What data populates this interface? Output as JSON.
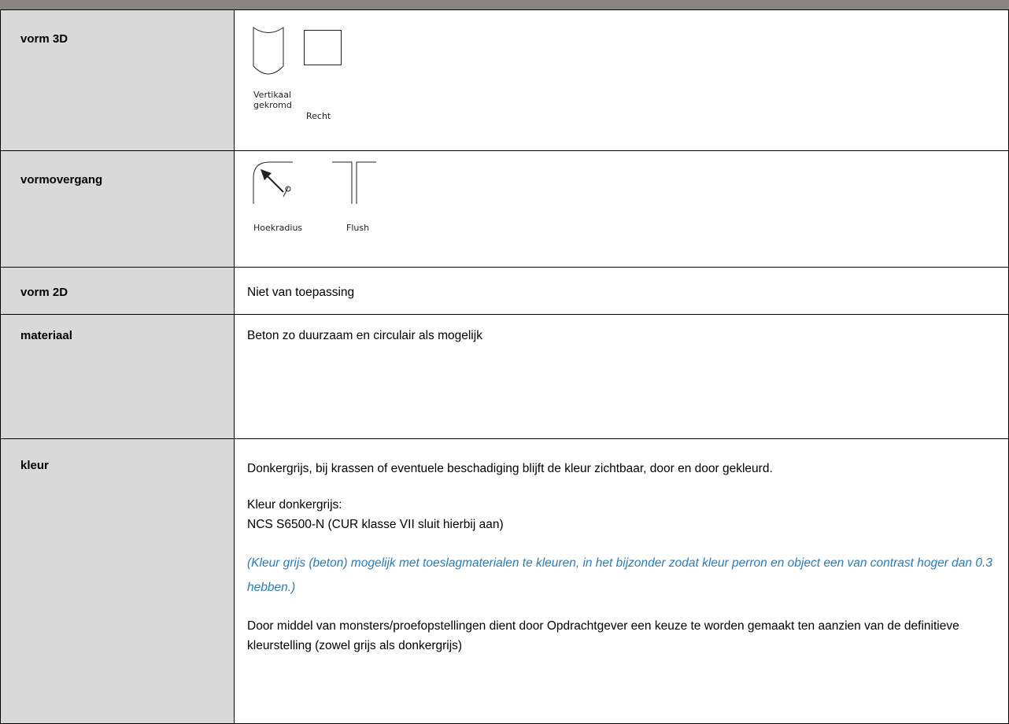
{
  "rows": [
    {
      "label": "vorm 3D",
      "shapes": [
        {
          "icon": "vertical-curved-shape-icon",
          "caption": "Vertikaal\ngekromd"
        },
        {
          "icon": "straight-shape-icon",
          "caption": "Recht"
        }
      ]
    },
    {
      "label": "vormovergang",
      "shapes": [
        {
          "icon": "corner-radius-icon",
          "caption": "Hoekradius"
        },
        {
          "icon": "flush-icon",
          "caption": "Flush"
        }
      ]
    },
    {
      "label": "vorm 2D",
      "value": "Niet van toepassing"
    },
    {
      "label": "materiaal",
      "value": "Beton zo duurzaam en circulair als mogelijk"
    },
    {
      "label": "kleur",
      "paragraphs": {
        "p1": "Donkergrijs, bij krassen of eventuele beschadiging blijft de kleur zichtbaar, door en door gekleurd.",
        "p2a": "Kleur donkergrijs:",
        "p2b": "NCS S6500-N (CUR klasse VII sluit hierbij aan)",
        "note": "(Kleur grijs (beton) mogelijk met toeslagmaterialen te kleuren, in het bijzonder zodat kleur perron en object een van contrast hoger dan 0.3 hebben.)",
        "p3": "Door middel van monsters/proefopstellingen dient door Opdrachtgever een keuze te worden gemaakt ten aanzien van de definitieve kleurstelling (zowel grijs als donkergrijs)"
      }
    }
  ],
  "colors": {
    "header_bar": "#8a8583",
    "label_bg": "#d9d9d9",
    "note_text": "#2a7bbd"
  }
}
